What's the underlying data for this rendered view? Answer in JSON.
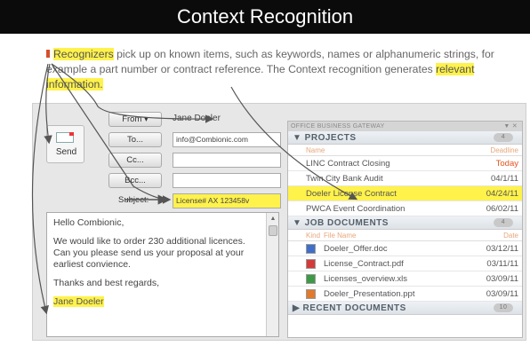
{
  "title": "Context Recognition",
  "intro": {
    "w_recognizers": "Recognizers",
    "t1": " pick up on known items, such as keywords, names or alphanumeric strings, for example a part number or contract reference. The Context recognition generates ",
    "w_relevant": "relevant information."
  },
  "email": {
    "send_label": "Send",
    "from_label": "From ▾",
    "from_value": "Jane Doeler",
    "to_label": "To...",
    "to_value": "info@Combionic.com",
    "cc_label": "Cc...",
    "bcc_label": "Bcc...",
    "subject_label": "Subject:",
    "subject_value": "License# AX 123458v",
    "greeting": "Hello Combionic,",
    "para1": "We would like to order 230 additional licences. Can you please send us your proposal at your earliest convience.",
    "para2": "Thanks and best regards,",
    "signature": "Jane Doeler"
  },
  "panel": {
    "header": "OFFICE BUSINESS GATEWAY",
    "header_controls": "▼ ✕",
    "projects": {
      "title": "▼ PROJECTS",
      "count": "4",
      "col_name": "Name",
      "col_deadline": "Deadline",
      "rows": [
        {
          "name": "LINC Contract Closing",
          "date": "Today"
        },
        {
          "name": "Twin City Bank Audit",
          "date": "04/1/11"
        },
        {
          "name": "Doeler License Contract",
          "date": "04/24/11"
        },
        {
          "name": "PWCA Event Coordination",
          "date": "06/02/11"
        }
      ]
    },
    "documents": {
      "title": "▼ JOB DOCUMENTS",
      "count": "4",
      "col_kind": "Kind",
      "col_name": "File Name",
      "col_date": "Date",
      "rows": [
        {
          "name": "Doeler_Offer.doc",
          "date": "03/12/11",
          "icon_color": "#3f6fc9"
        },
        {
          "name": "License_Contract.pdf",
          "date": "03/11/11",
          "icon_color": "#d33b3b"
        },
        {
          "name": "Licenses_overview.xls",
          "date": "03/09/11",
          "icon_color": "#3c9a45"
        },
        {
          "name": "Doeler_Presentation.ppt",
          "date": "03/09/11",
          "icon_color": "#e07a2c"
        }
      ]
    },
    "recent": {
      "title": "▶ RECENT DOCUMENTS",
      "count": "10"
    }
  }
}
